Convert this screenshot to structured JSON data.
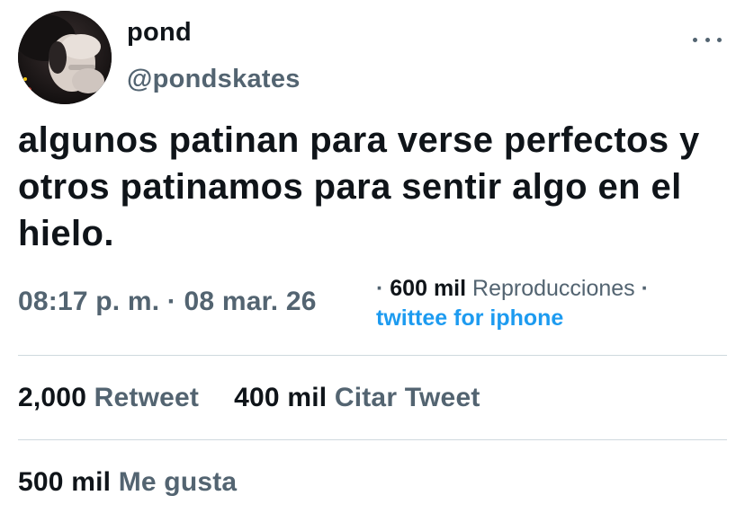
{
  "author": {
    "display_name": "pond",
    "handle": "@pondskates"
  },
  "tweet": {
    "text": "algunos patinan para verse perfectos y otros patinamos para sentir algo en el hielo."
  },
  "meta": {
    "time": "08:17 p. m. · 08 mar. 26",
    "separator": "·",
    "views_count": "600 mil",
    "views_label": "Reproducciones",
    "trailing_separator": "·",
    "source": "twittee for iphone"
  },
  "stats": {
    "retweets_count": "2,000",
    "retweets_label": "Retweet",
    "quotes_count": "400 mil",
    "quotes_label": "Citar Tweet",
    "likes_count": "500 mil",
    "likes_label": "Me gusta"
  },
  "icons": {
    "more": "more-horizontal-icon"
  },
  "colors": {
    "primary_text": "#0f1419",
    "secondary_text": "#536471",
    "link": "#1d9bf0",
    "divider": "#cfd9de"
  }
}
